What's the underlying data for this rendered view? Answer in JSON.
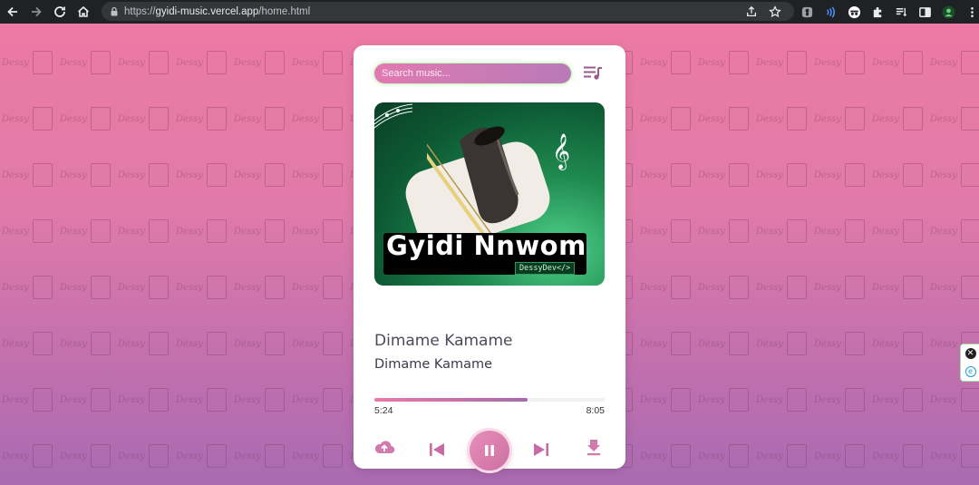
{
  "browser": {
    "url_scheme": "https://",
    "url_host": "gyidi-music.vercel.app",
    "url_path": "/home.html",
    "icons": [
      "back-icon",
      "forward-icon",
      "reload-icon",
      "home-icon",
      "lock-icon",
      "share-icon",
      "star-icon"
    ],
    "extensions": [
      "extension-a-icon",
      "extension-b-icon",
      "incognito-icon",
      "puzzle-icon",
      "reading-list-icon",
      "side-panel-icon",
      "profile-avatar",
      "menu-icon"
    ]
  },
  "background": {
    "watermark_text": "Dessy"
  },
  "player": {
    "search_placeholder": "Search music...",
    "cover": {
      "title": "Gyidi Nnwom",
      "credit": "DessyDev</>"
    },
    "song_title": "Dimame Kamame",
    "artist": "Dimame Kamame",
    "current_time": "5:24",
    "duration": "8:05",
    "progress_fraction": 0.667,
    "is_playing": true,
    "accent_color": "#d27aad"
  },
  "side_widget": {
    "close_glyph": "✕",
    "ext_glyph": "e"
  }
}
